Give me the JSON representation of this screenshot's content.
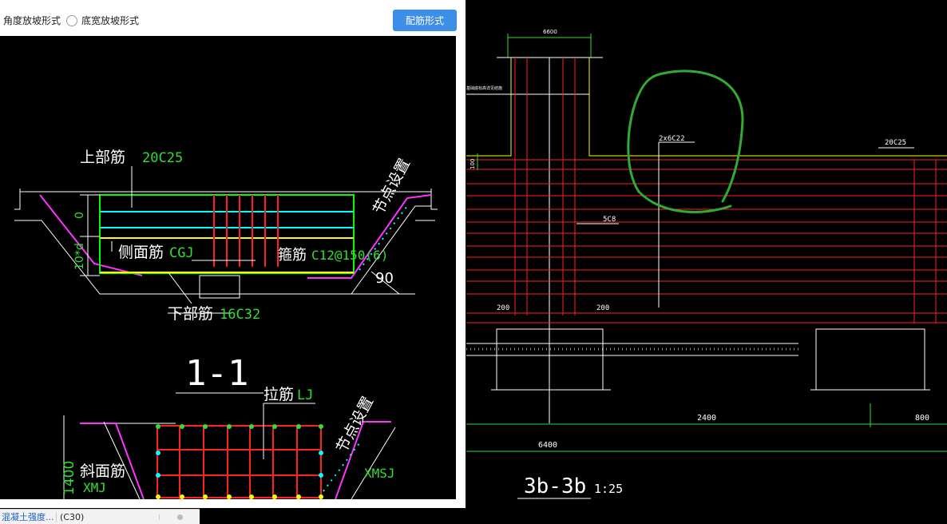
{
  "toolbar": {
    "radio_angle": "角度放坡形式",
    "radio_width": "底宽放坡形式",
    "rebar_button": "配筋形式"
  },
  "left_drawing": {
    "upper_rebar_label": "上部筋",
    "upper_rebar_value": "20C25",
    "side_rebar_label": "侧面筋",
    "side_rebar_value": "CGJ",
    "stirrup_label": "箍筋",
    "stirrup_value": "C12@150(6)",
    "lower_rebar_label": "下部筋",
    "lower_rebar_value": "16C32",
    "node_setting_1": "节点设置",
    "node_setting_2": "节点设置",
    "angle_value": "90",
    "zero_dim": "0",
    "d_dim": "10*d",
    "section_label": "1-1",
    "tie_label": "拉筋",
    "tie_value": "LJ",
    "slope_rebar_label": "斜面筋",
    "slope_rebar_value": "XMJ",
    "xmsj_value": "XMSJ",
    "dim_1400": "1400"
  },
  "right_drawing": {
    "top_dim": "6600",
    "side_note": "基础底标高详见结施",
    "label_2x6c22": "2x6C22",
    "label_20c25": "20C25",
    "label_5c8": "5C8",
    "dim_100": "100",
    "dim_200_left": "200",
    "dim_200_right": "200",
    "dim_2400": "2400",
    "dim_800": "800",
    "dim_6400": "6400",
    "section_title": "3b-3b",
    "scale": "1:25"
  },
  "bottom_bar": {
    "concrete_label": "混凝土强度...",
    "concrete_value": "(C30)"
  }
}
